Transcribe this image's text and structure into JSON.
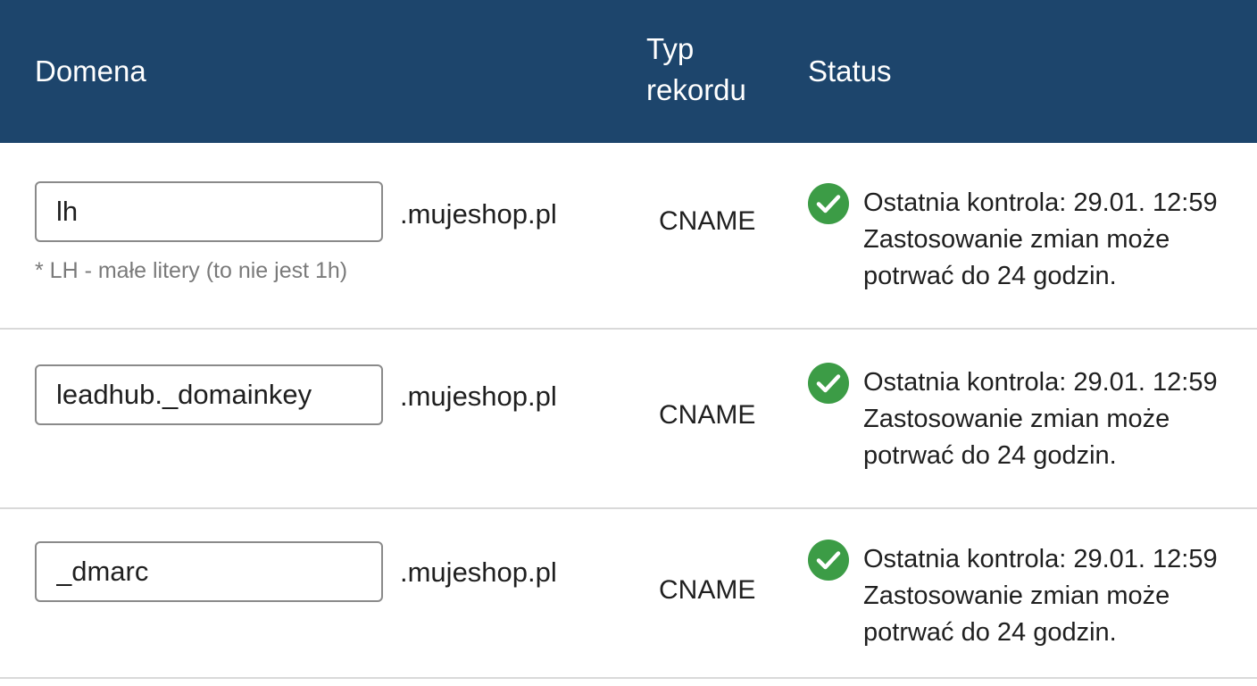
{
  "header": {
    "domain_label": "Domena",
    "type_label_line1": "Typ",
    "type_label_line2": "rekordu",
    "status_label": "Status"
  },
  "colors": {
    "header_bg": "#1d456c",
    "check_green": "#3c9c46"
  },
  "rows": [
    {
      "subdomain": "lh",
      "suffix": ".mujeshop.pl",
      "hint": "* LH - małe litery (to nie jest 1h)",
      "record_type": "CNAME",
      "status_icon": "check-circle-icon",
      "status_line1": "Ostatnia kontrola: 29.01. 12:59",
      "status_line2": "Zastosowanie zmian może",
      "status_line3": "potrwać do 24 godzin."
    },
    {
      "subdomain": "leadhub._domainkey",
      "suffix": ".mujeshop.pl",
      "record_type": "CNAME",
      "status_icon": "check-circle-icon",
      "status_line1": "Ostatnia kontrola: 29.01. 12:59",
      "status_line2": "Zastosowanie zmian może",
      "status_line3": "potrwać do 24 godzin."
    },
    {
      "subdomain": "_dmarc",
      "suffix": ".mujeshop.pl",
      "record_type": "CNAME",
      "status_icon": "check-circle-icon",
      "status_line1": "Ostatnia kontrola: 29.01. 12:59",
      "status_line2": "Zastosowanie zmian może",
      "status_line3": "potrwać do 24 godzin."
    }
  ]
}
